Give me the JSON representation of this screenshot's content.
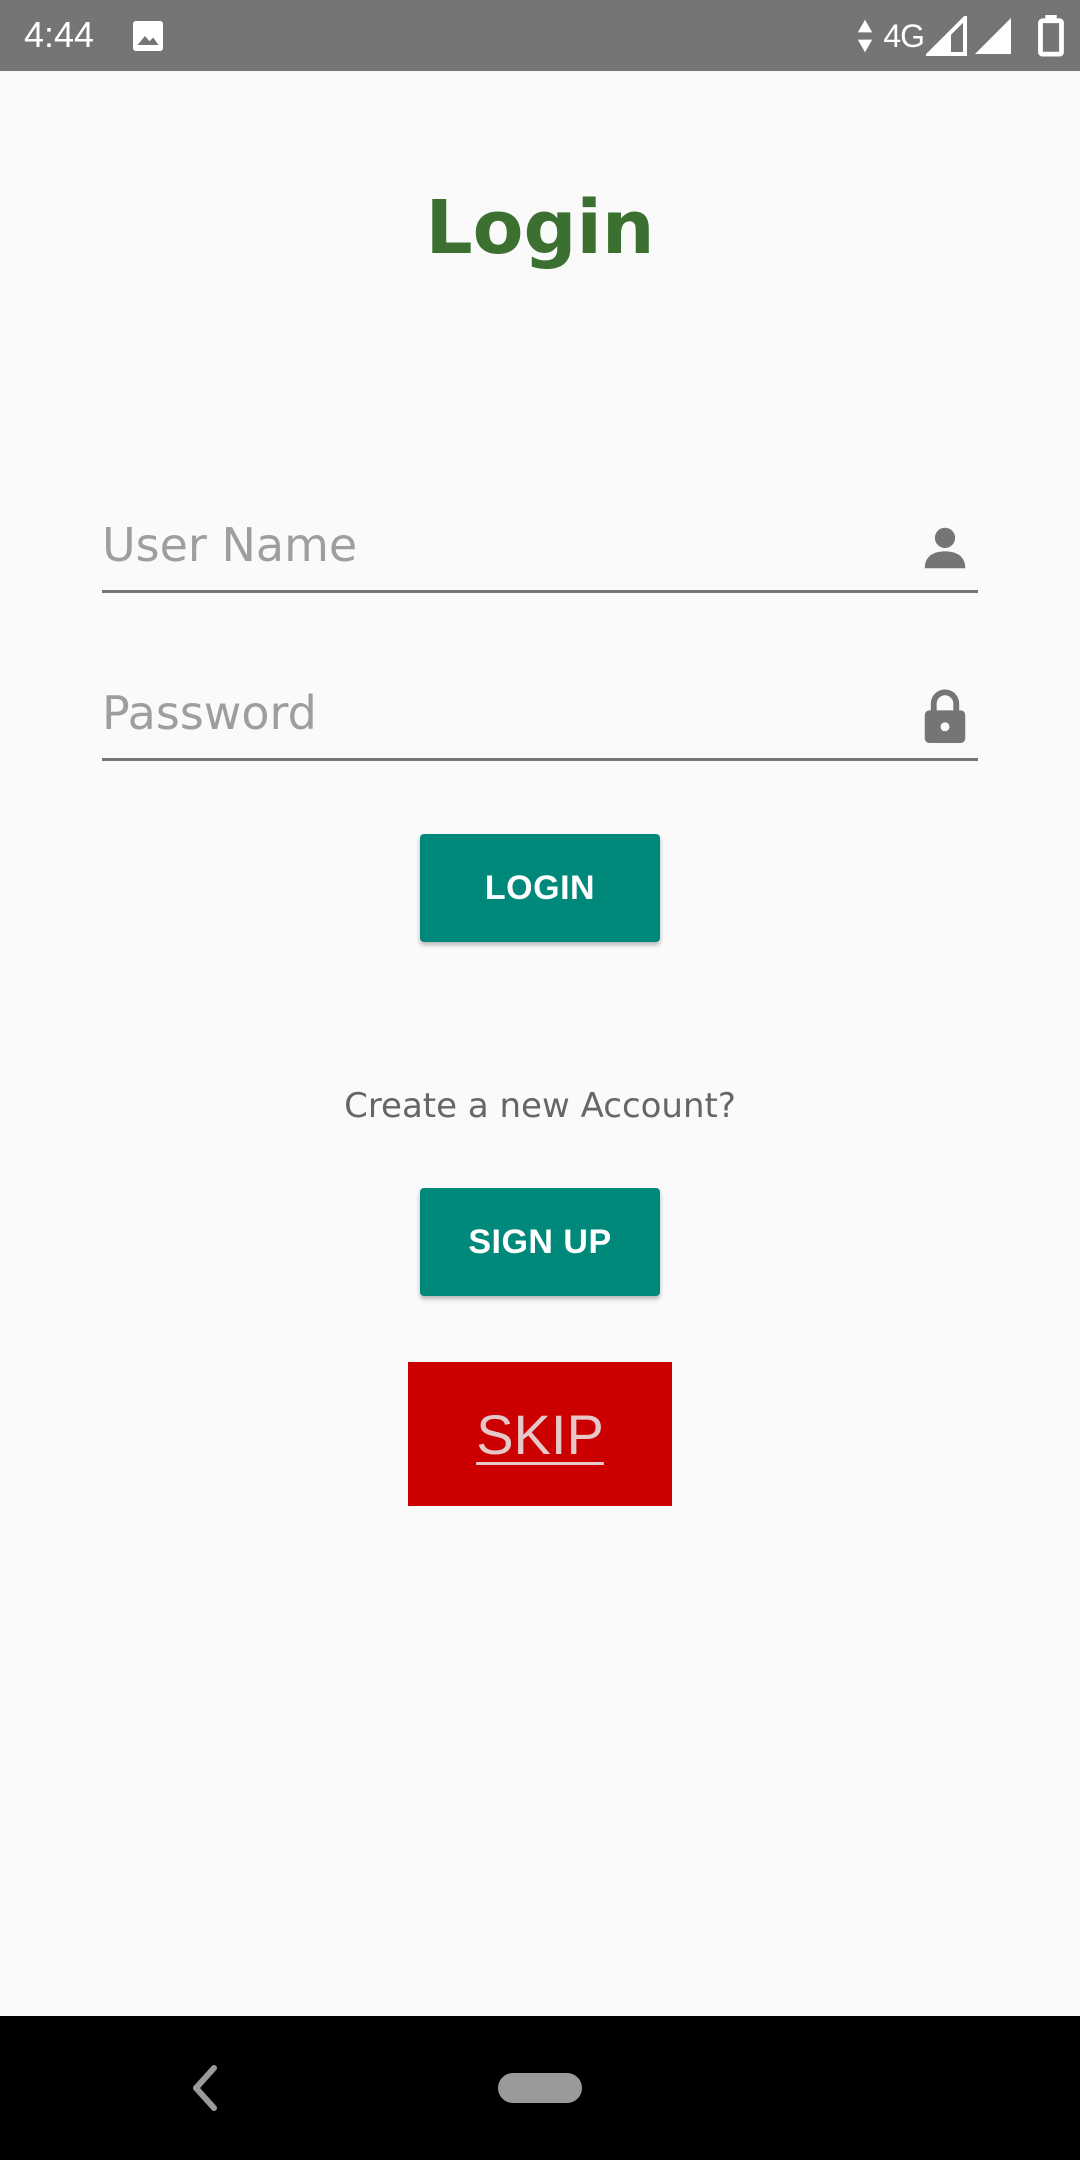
{
  "status_bar": {
    "time": "4:44",
    "network_type": "4G",
    "icons": [
      "image-icon",
      "data-arrows-icon",
      "signal-icon",
      "battery-icon"
    ]
  },
  "login_screen": {
    "title": "Login",
    "username_placeholder": "User Name",
    "password_placeholder": "Password",
    "login_button": "LOGIN",
    "create_account_text": "Create a new Account?",
    "signup_button": "SIGN UP",
    "skip_button": "SKIP"
  },
  "colors": {
    "title": "#3b7030",
    "button_primary": "#00897b",
    "skip_background": "#cc0000",
    "status_bar": "#757575",
    "background": "#fafafa"
  },
  "navigation_bar": {
    "icons": [
      "back-icon",
      "home-pill"
    ]
  }
}
